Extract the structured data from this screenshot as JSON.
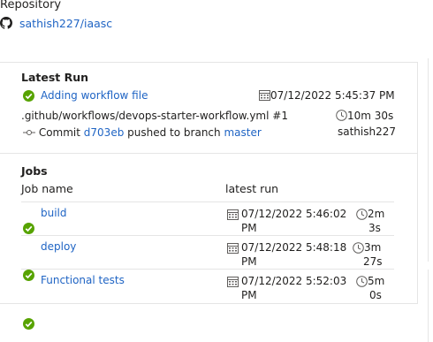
{
  "repo": {
    "heading": "Repository",
    "name": "sathish227/iaasc"
  },
  "latest_run": {
    "title": "Latest Run",
    "workflow_name": "Adding workflow file",
    "timestamp": "07/12/2022 5:45:37 PM",
    "workflow_path": ".github/workflows/devops-starter-workflow.yml #1",
    "duration": "10m 30s",
    "commit_label": "Commit",
    "commit_hash": "d703eb",
    "pushed_text": "pushed to branch",
    "branch": "master",
    "author": "sathish227"
  },
  "jobs": {
    "title": "Jobs",
    "col_name": "Job name",
    "col_run": "latest run",
    "items": [
      {
        "name": "build",
        "date": "07/12/2022 5:46:02",
        "ampm": "PM",
        "dur1": "2m",
        "dur2": "3s"
      },
      {
        "name": "deploy",
        "date": "07/12/2022 5:48:18",
        "ampm": "PM",
        "dur1": "3m",
        "dur2": "27s"
      },
      {
        "name": "Functional tests",
        "date": "07/12/2022 5:52:03",
        "ampm": "PM",
        "dur1": "5m",
        "dur2": "0s"
      }
    ]
  },
  "colors": {
    "link": "#1f64c4",
    "success": "#57a300",
    "divider": "#e5e5e5"
  }
}
